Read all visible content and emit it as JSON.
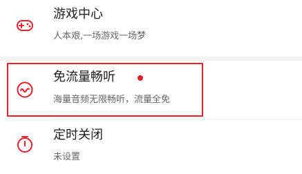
{
  "menu": {
    "items": [
      {
        "title": "游戏中心",
        "subtitle": "人本艰,一场游戏一场梦",
        "icon": "gamepad-icon"
      },
      {
        "title": "免流量畅听",
        "subtitle": "海量音频无限畅听，流量全免",
        "icon": "headphone-wave-icon",
        "has_new_dot": true
      },
      {
        "title": "定时关闭",
        "subtitle": "未设置",
        "icon": "timer-icon"
      }
    ]
  },
  "colors": {
    "accent": "#e0202a",
    "highlight_border": "#e0262d",
    "separator": "#f4f4f4"
  }
}
